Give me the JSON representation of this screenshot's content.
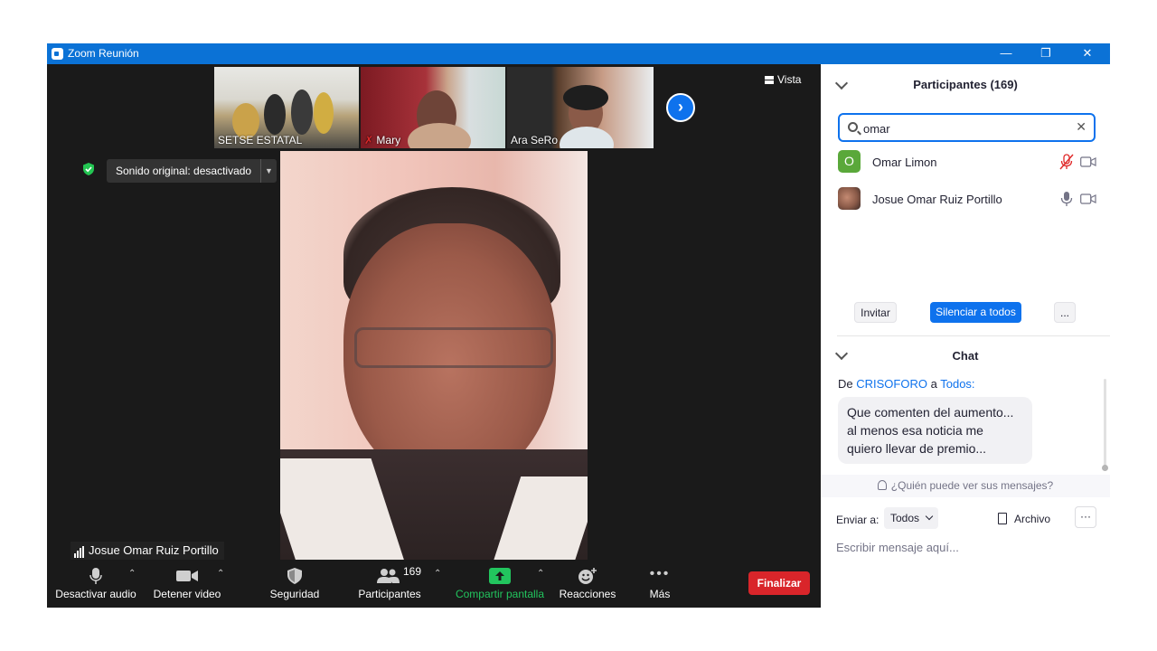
{
  "window": {
    "title": "Zoom Reunión",
    "minimize": "—",
    "restore": "❐",
    "close": "✕"
  },
  "gallery": {
    "thumbnails": [
      {
        "name": "SETSE ESTATAL"
      },
      {
        "name": "Mary"
      },
      {
        "name": "Ara SeRo"
      }
    ],
    "view_label": "Vista"
  },
  "audio": {
    "sound_original": "Sonido original: desactivado"
  },
  "active_speaker": {
    "name": "Josue Omar Ruiz Portillo"
  },
  "toolbar": {
    "audio_label": "Desactivar audio",
    "video_label": "Detener video",
    "security_label": "Seguridad",
    "participants_label": "Participantes",
    "participants_count": "169",
    "share_label": "Compartir pantalla",
    "reactions_label": "Reacciones",
    "more_label": "Más",
    "end_label": "Finalizar"
  },
  "participants_panel": {
    "title": "Participantes (169)",
    "search_value": "omar",
    "list": [
      {
        "initial": "O",
        "name": "Omar Limon",
        "avatar_color": "#5aa83a"
      },
      {
        "initial": "",
        "name": "Josue Omar Ruiz Portillo"
      }
    ],
    "invite_label": "Invitar",
    "mute_all_label": "Silenciar a todos",
    "more_label": "..."
  },
  "chat_panel": {
    "title": "Chat",
    "from_prefix": "De",
    "from_sender": "CRISOFORO",
    "from_middle": "a",
    "from_recipient": "Todos:",
    "message_lines": [
      "Que comenten del aumento...",
      "al menos esa noticia me",
      "quiero llevar de premio..."
    ],
    "who_sees": "¿Quién puede ver sus mensajes?",
    "send_to_label": "Enviar a:",
    "send_to_value": "Todos",
    "file_label": "Archivo",
    "more_label": "···",
    "input_placeholder": "Escribir mensaje aquí..."
  },
  "colors": {
    "accent": "#0e72ed",
    "title_bar": "#0b72d6",
    "end_button": "#d9252a",
    "share_green": "#22c55e",
    "muted_red": "#e02828"
  }
}
